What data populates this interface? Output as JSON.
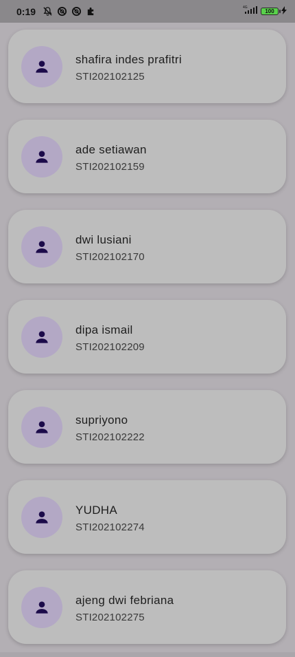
{
  "status_bar": {
    "time": "0:19",
    "battery": "100",
    "left_icons": [
      "notifications-off-icon",
      "blocked-icon",
      "blocked-icon",
      "puzzle-icon"
    ],
    "right_icons": [
      "signal-4g-icon",
      "battery-icon",
      "charging-bolt-icon"
    ]
  },
  "students": [
    {
      "name": "shafira indes prafitri",
      "nim": "STI202102125"
    },
    {
      "name": "ade setiawan",
      "nim": "STI202102159"
    },
    {
      "name": "dwi lusiani",
      "nim": "STI202102170"
    },
    {
      "name": "dipa ismail",
      "nim": "STI202102209"
    },
    {
      "name": "supriyono",
      "nim": "STI202102222"
    },
    {
      "name": "YUDHA",
      "nim": "STI202102274"
    },
    {
      "name": "ajeng dwi febriana",
      "nim": "STI202102275"
    }
  ],
  "colors": {
    "card": "#bdbdbd",
    "avatar_bg": "#b3a8c5",
    "avatar_icon": "#1c0b4a",
    "background": "#b3afb4"
  }
}
